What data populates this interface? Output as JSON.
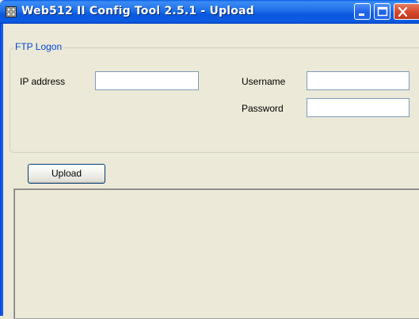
{
  "window": {
    "title": "Web512 II Config Tool 2.5.1 - Upload",
    "icon": "app-icon",
    "controls": [
      "minimize-icon",
      "maximize-icon",
      "close-icon"
    ]
  },
  "ftp_logon": {
    "legend": "FTP Logon",
    "ip_address": {
      "label": "IP address",
      "value": ""
    },
    "username": {
      "label": "Username",
      "value": ""
    },
    "password": {
      "label": "Password",
      "value": ""
    }
  },
  "actions": {
    "upload_label": "Upload"
  },
  "log": {
    "text": ""
  },
  "colors": {
    "titlebar": "#0a59e0",
    "window_bg": "#ece9d8",
    "legend_text": "#0046d5",
    "close_button": "#d2442a"
  }
}
